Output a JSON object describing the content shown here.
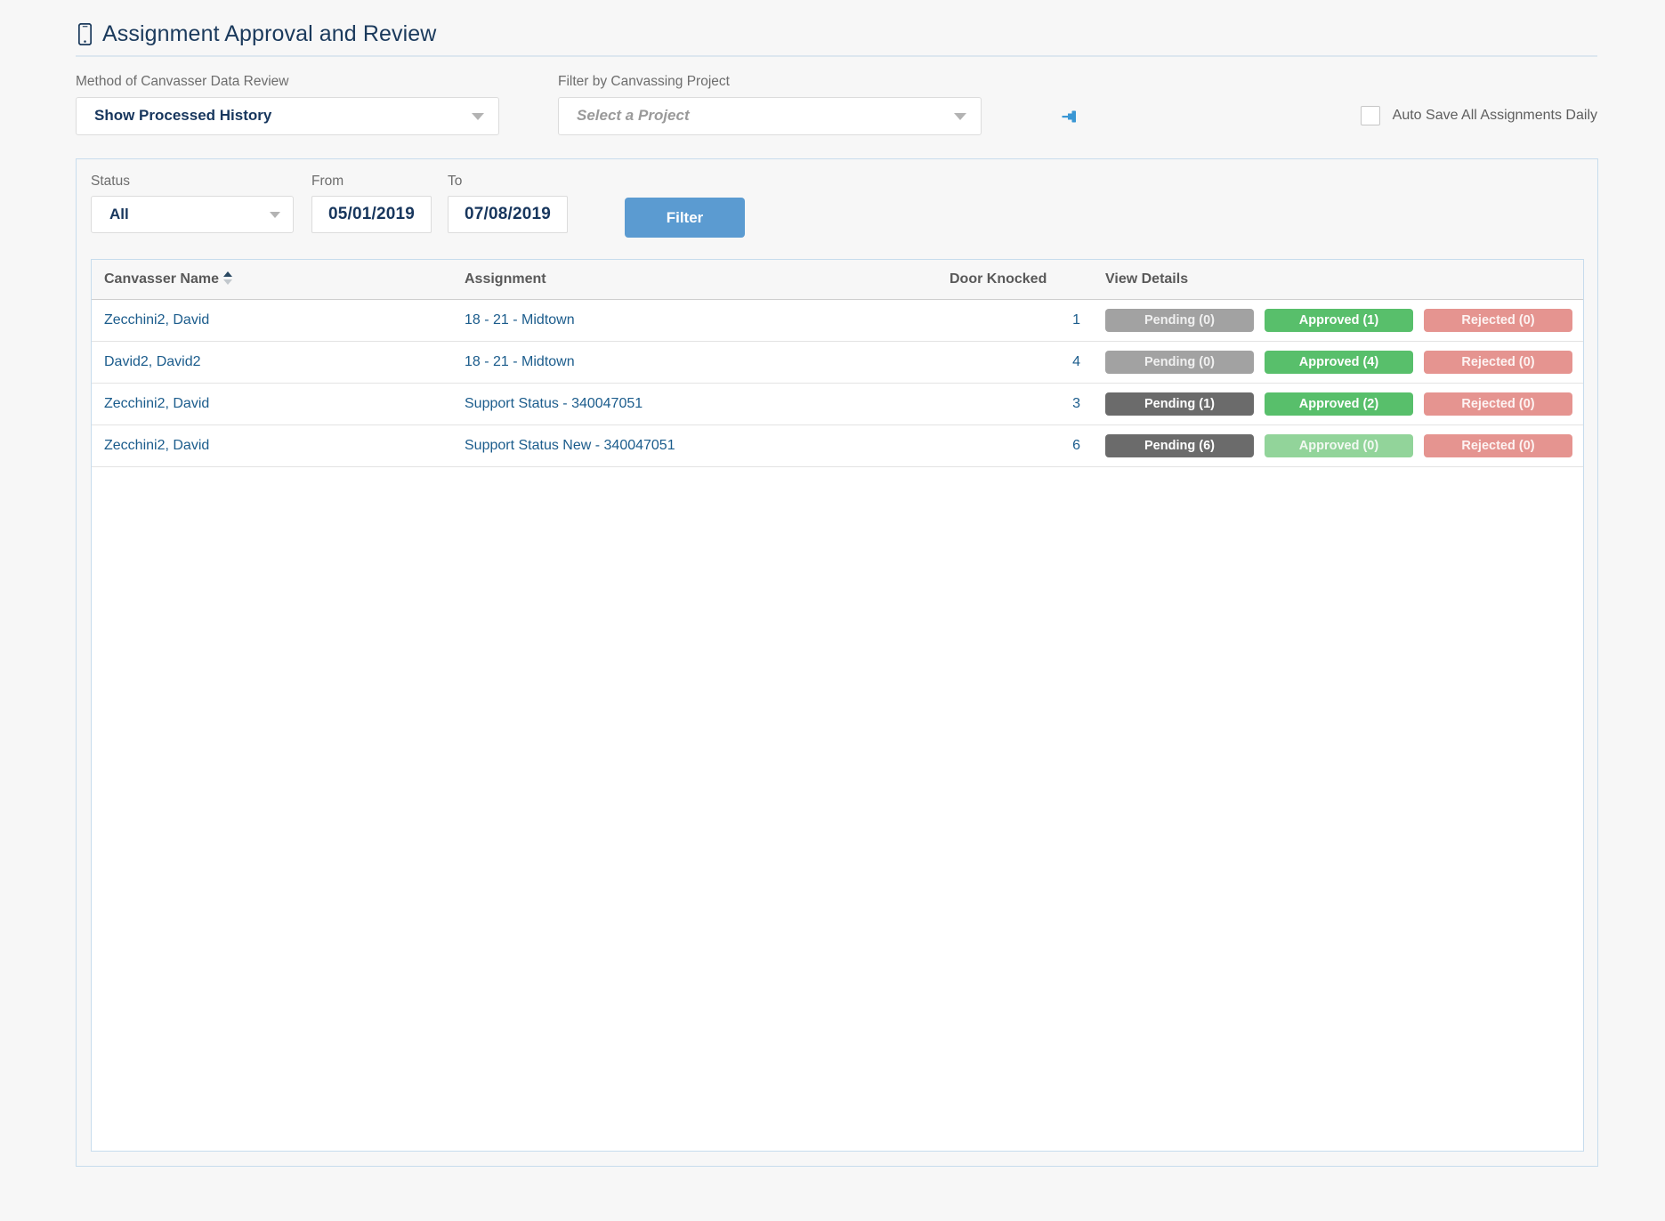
{
  "header": {
    "title": "Assignment Approval and Review",
    "icon": "mobile-phone-icon"
  },
  "top_filters": {
    "method": {
      "label": "Method of Canvasser Data Review",
      "value": "Show Processed History",
      "caret_icon": "chevron-down-icon",
      "pin_icon": "pin-icon"
    },
    "project": {
      "label": "Filter by Canvassing Project",
      "value": "",
      "placeholder": "Select a Project",
      "caret_icon": "chevron-down-icon",
      "pin_icon": "pin-icon"
    },
    "auto_save": {
      "label": "Auto Save All Assignments Daily",
      "checked": false
    }
  },
  "filter_bar": {
    "status": {
      "label": "Status",
      "value": "All"
    },
    "from": {
      "label": "From",
      "value": "05/01/2019"
    },
    "to": {
      "label": "To",
      "value": "07/08/2019"
    },
    "filter_button": "Filter"
  },
  "table": {
    "columns": {
      "name": "Canvasser Name",
      "assignment": "Assignment",
      "door_knocked": "Door Knocked",
      "view_details": "View Details"
    },
    "sort": {
      "column": "Canvasser Name",
      "direction": "asc"
    },
    "rows": [
      {
        "name": "Zecchini2, David",
        "assignment": "18 - 21 - Midtown",
        "door_knocked": "1",
        "pending": "Pending (0)",
        "approved": "Approved (1)",
        "rejected": "Rejected (0)",
        "pending_count": 0,
        "approved_count": 1,
        "rejected_count": 0
      },
      {
        "name": "David2, David2",
        "assignment": "18 - 21 - Midtown",
        "door_knocked": "4",
        "pending": "Pending (0)",
        "approved": "Approved (4)",
        "rejected": "Rejected (0)",
        "pending_count": 0,
        "approved_count": 4,
        "rejected_count": 0
      },
      {
        "name": "Zecchini2, David",
        "assignment": "Support Status - 340047051",
        "door_knocked": "3",
        "pending": "Pending (1)",
        "approved": "Approved (2)",
        "rejected": "Rejected (0)",
        "pending_count": 1,
        "approved_count": 2,
        "rejected_count": 0
      },
      {
        "name": "Zecchini2, David",
        "assignment": "Support Status New - 340047051",
        "door_knocked": "6",
        "pending": "Pending (6)",
        "approved": "Approved (0)",
        "rejected": "Rejected (0)",
        "pending_count": 6,
        "approved_count": 0,
        "rejected_count": 0
      }
    ]
  },
  "colors": {
    "accent_blue": "#5b9bd1",
    "pin_blue": "#3a97d4",
    "title_navy": "#1b3a5c",
    "link_blue": "#1b5c8c",
    "pending_active": "#6b6b6b",
    "pending_muted": "#a2a2a2",
    "approved_active": "#58bf6b",
    "approved_muted": "#92d49a",
    "rejected_active": "#dd6c66",
    "rejected_muted": "#e59490",
    "page_bg": "#f7f7f7",
    "panel_border": "#c7dced"
  }
}
